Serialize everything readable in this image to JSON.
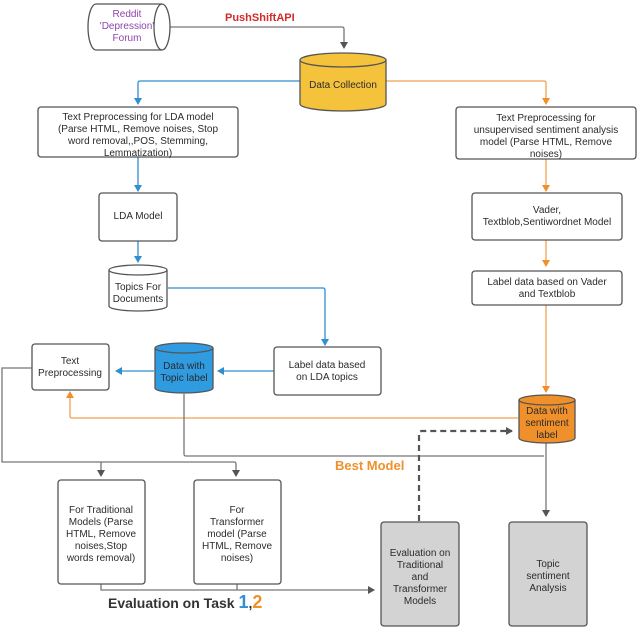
{
  "colors": {
    "blue_flow": "#2f8fd0",
    "orange_flow": "#f0a050",
    "gray_flow": "#777777",
    "data_collection_fill": "#f5c33b",
    "topic_label_fill": "#2f9be0",
    "sentiment_label_fill": "#f0902a",
    "evaluation_fill": "#d3d3d3",
    "api_label": "#d42a2a",
    "best_model_label": "#f0902a"
  },
  "nodes": {
    "reddit": [
      "Reddit",
      "'Depression'",
      "Forum"
    ],
    "data_collection": [
      "Data Collection"
    ],
    "lda_preprocessing": [
      "Text Preprocessing for LDA model",
      "(Parse HTML, Remove noises, Stop",
      "word removal,,POS, Stemming,",
      "Lemmatization)"
    ],
    "sentiment_preprocessing": [
      "Text Preprocessing for",
      "unsupervised sentiment analysis",
      "model (Parse HTML, Remove",
      "noises)"
    ],
    "lda_model": [
      "LDA Model"
    ],
    "sentiment_models": [
      "Vader,",
      "Textblob,Sentiwordnet Model"
    ],
    "topics_for_documents": [
      "Topics For",
      "Documents"
    ],
    "label_vader": [
      "Label data based on Vader",
      "and Textblob"
    ],
    "text_preprocessing": [
      "Text",
      "Preprocessing"
    ],
    "data_topic_label": [
      "Data with",
      "Topic label"
    ],
    "label_lda": [
      "Label data based",
      "on LDA topics"
    ],
    "data_sentiment_label": [
      "Data with",
      "sentiment",
      "label"
    ],
    "traditional_models": [
      "For Traditional",
      "Models (Parse",
      "HTML, Remove",
      "noises,Stop",
      "words removal)"
    ],
    "transformer_model": [
      "For",
      "Transformer",
      "model (Parse",
      "HTML, Remove",
      "noises)"
    ],
    "evaluation": [
      "Evaluation on",
      "Traditional",
      "and",
      "Transformer",
      "Models"
    ],
    "topic_sentiment": [
      "Topic",
      "sentiment",
      "Analysis"
    ]
  },
  "labels": {
    "api": "PushShiftAPI",
    "best_model": "Best Model",
    "evaluation_task": "Evaluation on Task ",
    "task_1": "1",
    "task_sep": ",",
    "task_2": "2"
  }
}
